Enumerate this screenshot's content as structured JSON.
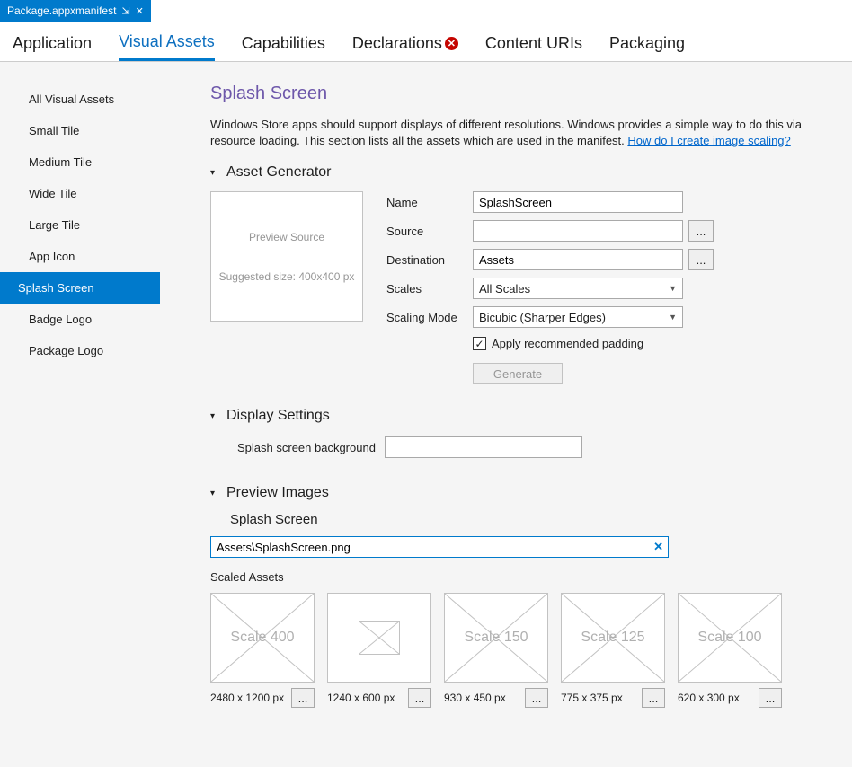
{
  "docTab": {
    "title": "Package.appxmanifest",
    "pin": "⊣",
    "close": "✕"
  },
  "mainTabs": [
    {
      "label": "Application",
      "hasError": false
    },
    {
      "label": "Visual Assets",
      "hasError": false
    },
    {
      "label": "Capabilities",
      "hasError": false
    },
    {
      "label": "Declarations",
      "hasError": true
    },
    {
      "label": "Content URIs",
      "hasError": false
    },
    {
      "label": "Packaging",
      "hasError": false
    }
  ],
  "activeMainTab": 1,
  "sidebar": [
    "All Visual Assets",
    "Small Tile",
    "Medium Tile",
    "Wide Tile",
    "Large Tile",
    "App Icon",
    "Splash Screen",
    "Badge Logo",
    "Package Logo"
  ],
  "selectedSidebar": 6,
  "page": {
    "title": "Splash Screen",
    "desc1": "Windows Store apps should support displays of different resolutions. Windows provides a simple way to do this via resource loading. This section lists all the assets which are used in the manifest. ",
    "descLink": "How do I create image scaling?"
  },
  "assetGen": {
    "header": "Asset Generator",
    "preview1": "Preview Source",
    "preview2": "Suggested size: 400x400 px",
    "labels": {
      "name": "Name",
      "source": "Source",
      "destination": "Destination",
      "scales": "Scales",
      "scalingMode": "Scaling Mode"
    },
    "nameValue": "SplashScreen",
    "sourceValue": "",
    "destValue": "Assets",
    "scalesValue": "All Scales",
    "scalingModeValue": "Bicubic (Sharper Edges)",
    "padLabel": "Apply recommended padding",
    "padChecked": true,
    "generate": "Generate",
    "browse": "..."
  },
  "displaySettings": {
    "header": "Display Settings",
    "bgLabel": "Splash screen background",
    "bgValue": ""
  },
  "previewImages": {
    "header": "Preview Images",
    "subTitle": "Splash Screen",
    "path": "Assets\\SplashScreen.png",
    "scaledLabel": "Scaled Assets",
    "items": [
      {
        "label": "Scale 400",
        "dim": "2480 x 1200 px",
        "placeholder": false
      },
      {
        "label": "",
        "dim": "1240 x 600 px",
        "placeholder": true
      },
      {
        "label": "Scale 150",
        "dim": "930 x 450 px",
        "placeholder": false
      },
      {
        "label": "Scale 125",
        "dim": "775 x 375 px",
        "placeholder": false
      },
      {
        "label": "Scale 100",
        "dim": "620 x 300 px",
        "placeholder": false
      }
    ],
    "browse": "..."
  }
}
